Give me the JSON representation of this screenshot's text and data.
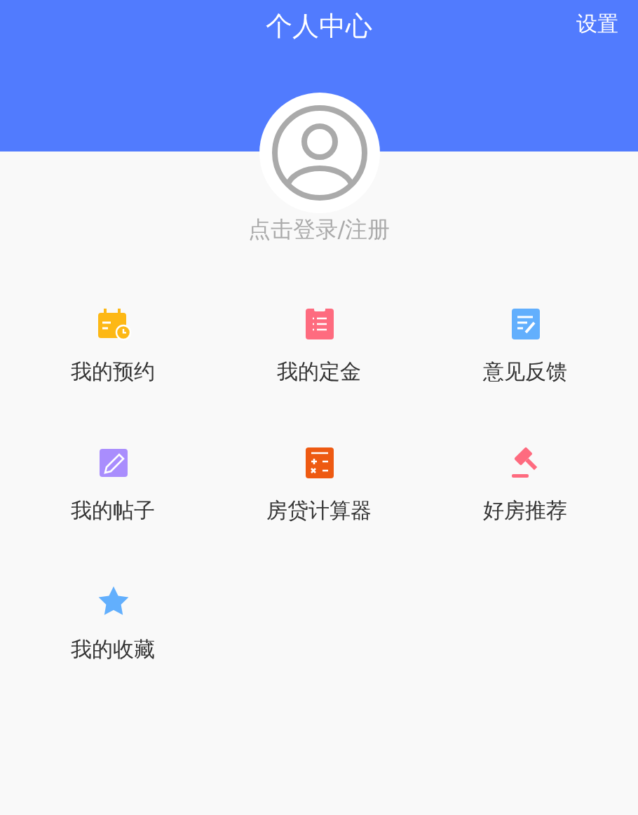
{
  "header": {
    "title": "个人中心",
    "settings": "设置"
  },
  "login": {
    "text": "点击登录/注册"
  },
  "menu": [
    {
      "label": "我的预约",
      "kind": "calendar"
    },
    {
      "label": "我的定金",
      "kind": "clipboard"
    },
    {
      "label": "意见反馈",
      "kind": "note"
    },
    {
      "label": "我的帖子",
      "kind": "pencil"
    },
    {
      "label": "房贷计算器",
      "kind": "calculator"
    },
    {
      "label": "好房推荐",
      "kind": "gavel"
    },
    {
      "label": "我的收藏",
      "kind": "star"
    }
  ]
}
